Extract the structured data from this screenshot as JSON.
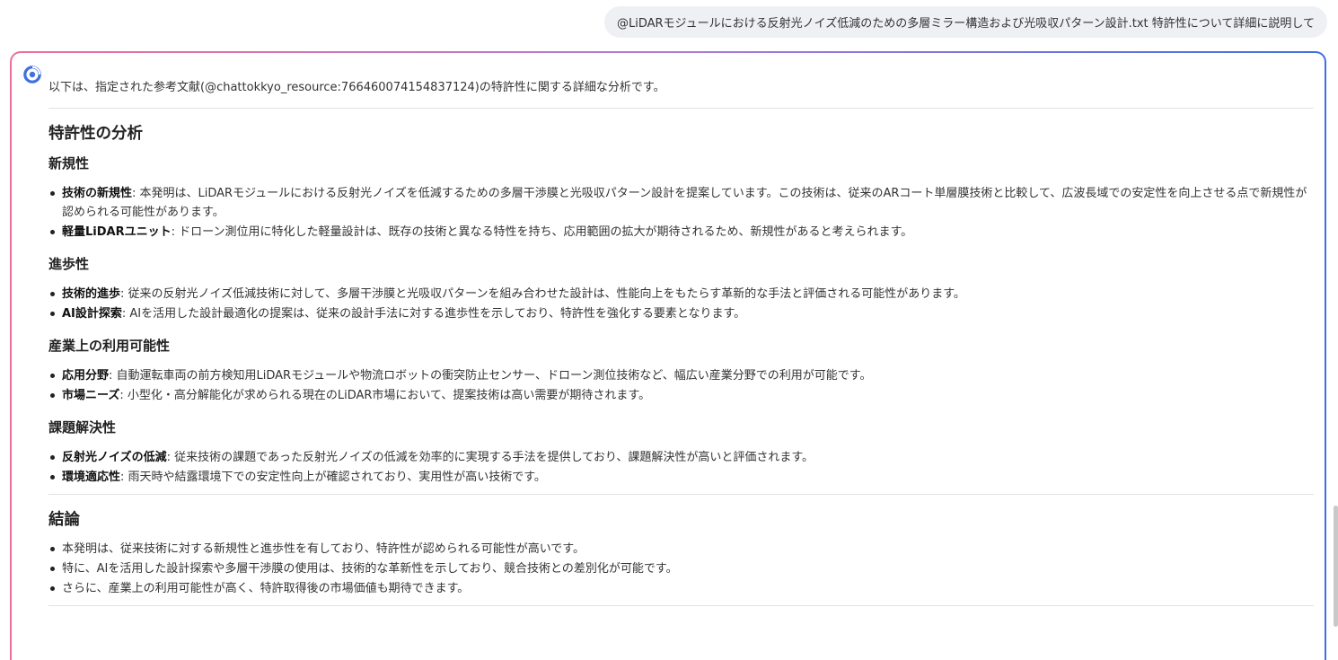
{
  "user_query": {
    "text": "@LiDARモジュールにおける反射光ノイズ低減のための多層ミラー構造および光吸収パターン設計.txt 特許性について詳細に説明して"
  },
  "assistant": {
    "intro": "以下は、指定された参考文献(@chattokkyo_resource:766460074154837124)の特許性に関する詳細な分析です。",
    "heading_main": "特許性の分析",
    "sections": [
      {
        "title": "新規性",
        "items": [
          {
            "term": "技術の新規性",
            "text": ": 本発明は、LiDARモジュールにおける反射光ノイズを低減するための多層干渉膜と光吸収パターン設計を提案しています。この技術は、従来のARコート単層膜技術と比較して、広波長域での安定性を向上させる点で新規性が認められる可能性があります。"
          },
          {
            "term": "軽量LiDARユニット",
            "text": ": ドローン測位用に特化した軽量設計は、既存の技術と異なる特性を持ち、応用範囲の拡大が期待されるため、新規性があると考えられます。"
          }
        ]
      },
      {
        "title": "進歩性",
        "items": [
          {
            "term": "技術的進歩",
            "text": ": 従来の反射光ノイズ低減技術に対して、多層干渉膜と光吸収パターンを組み合わせた設計は、性能向上をもたらす革新的な手法と評価される可能性があります。"
          },
          {
            "term": "AI設計探索",
            "text": ": AIを活用した設計最適化の提案は、従来の設計手法に対する進歩性を示しており、特許性を強化する要素となります。"
          }
        ]
      },
      {
        "title": "産業上の利用可能性",
        "items": [
          {
            "term": "応用分野",
            "text": ": 自動運転車両の前方検知用LiDARモジュールや物流ロボットの衝突防止センサー、ドローン測位技術など、幅広い産業分野での利用が可能です。"
          },
          {
            "term": "市場ニーズ",
            "text": ": 小型化・高分解能化が求められる現在のLiDAR市場において、提案技術は高い需要が期待されます。"
          }
        ]
      },
      {
        "title": "課題解決性",
        "items": [
          {
            "term": "反射光ノイズの低減",
            "text": ": 従来技術の課題であった反射光ノイズの低減を効率的に実現する手法を提供しており、課題解決性が高いと評価されます。"
          },
          {
            "term": "環境適応性",
            "text": ": 雨天時や結露環境下での安定性向上が確認されており、実用性が高い技術です。"
          }
        ]
      }
    ],
    "conclusion_heading": "結論",
    "conclusion_items": [
      "本発明は、従来技術に対する新規性と進歩性を有しており、特許性が認められる可能性が高いです。",
      "特に、AIを活用した設計探索や多層干渉膜の使用は、技術的な革新性を示しており、競合技術との差別化が可能です。",
      "さらに、産業上の利用可能性が高く、特許取得後の市場価値も期待できます。"
    ]
  },
  "colors": {
    "gradient_start": "#ec6f9d",
    "gradient_mid": "#b07ad6",
    "gradient_end": "#3f6fe0",
    "logo": "#3f6fe0",
    "bubble_bg": "#eef0f4"
  },
  "icons": {
    "assistant_logo": "assistant-logo-icon"
  }
}
